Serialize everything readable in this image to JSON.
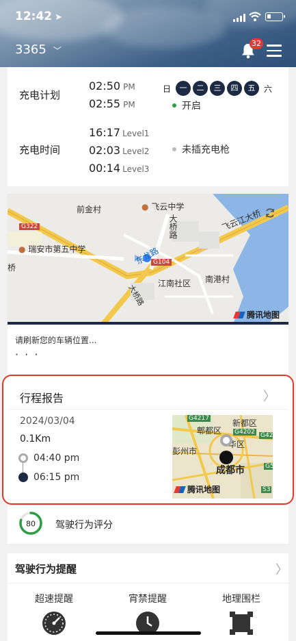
{
  "status_bar": {
    "time": "12:42",
    "battery_level": 0.25
  },
  "header": {
    "vehicle_id": "3365",
    "notification_count": "32"
  },
  "charge_plan": {
    "label": "充电计划",
    "start_time": "02:50",
    "start_period": "PM",
    "end_time": "02:55",
    "end_period": "PM",
    "days": [
      {
        "label": "日",
        "active": false
      },
      {
        "label": "一",
        "active": true
      },
      {
        "label": "二",
        "active": true
      },
      {
        "label": "三",
        "active": true
      },
      {
        "label": "四",
        "active": true
      },
      {
        "label": "五",
        "active": true
      },
      {
        "label": "六",
        "active": false
      }
    ],
    "status": "开启",
    "status_color": "#2e9e44"
  },
  "charge_time": {
    "label": "充电时间",
    "levels": [
      {
        "time": "16:17",
        "level": "Level1"
      },
      {
        "time": "02:03",
        "level": "Level2"
      },
      {
        "time": "00:14",
        "level": "Level3"
      }
    ],
    "status": "未插充电枪",
    "status_color": "#bbbbbb"
  },
  "map": {
    "labels": [
      "前金村",
      "飞云中学",
      "瑞安市第五中学",
      "大桥路",
      "东龙路",
      "飞云江大桥",
      "江南社区",
      "南港村",
      "桥"
    ],
    "road_tags": [
      "G322",
      "G104"
    ],
    "provider": "腾讯地图"
  },
  "location": {
    "message": "请刷新您的车辆位置...",
    "ellipsis": "· · ·"
  },
  "trip": {
    "title": "行程报告",
    "date": "2024/03/04",
    "distance": "0.1Km",
    "start_time": "04:40 pm",
    "end_time": "06:15 pm",
    "map_labels": [
      "G4217",
      "新都区",
      "郫都区",
      "G4202",
      "G42",
      "华区",
      "成都市",
      "G5",
      "S3",
      "彭州市"
    ],
    "provider": "腾讯地图"
  },
  "score": {
    "value": "80",
    "label": "驾驶行为评分",
    "fraction": 0.8,
    "color": "#2e9e44"
  },
  "alerts": {
    "title": "驾驶行为提醒",
    "items": [
      {
        "label": "超速提醒",
        "icon": "speedometer-icon"
      },
      {
        "label": "宵禁提醒",
        "icon": "clock-icon"
      },
      {
        "label": "地理围栏",
        "icon": "geofence-icon"
      }
    ]
  }
}
